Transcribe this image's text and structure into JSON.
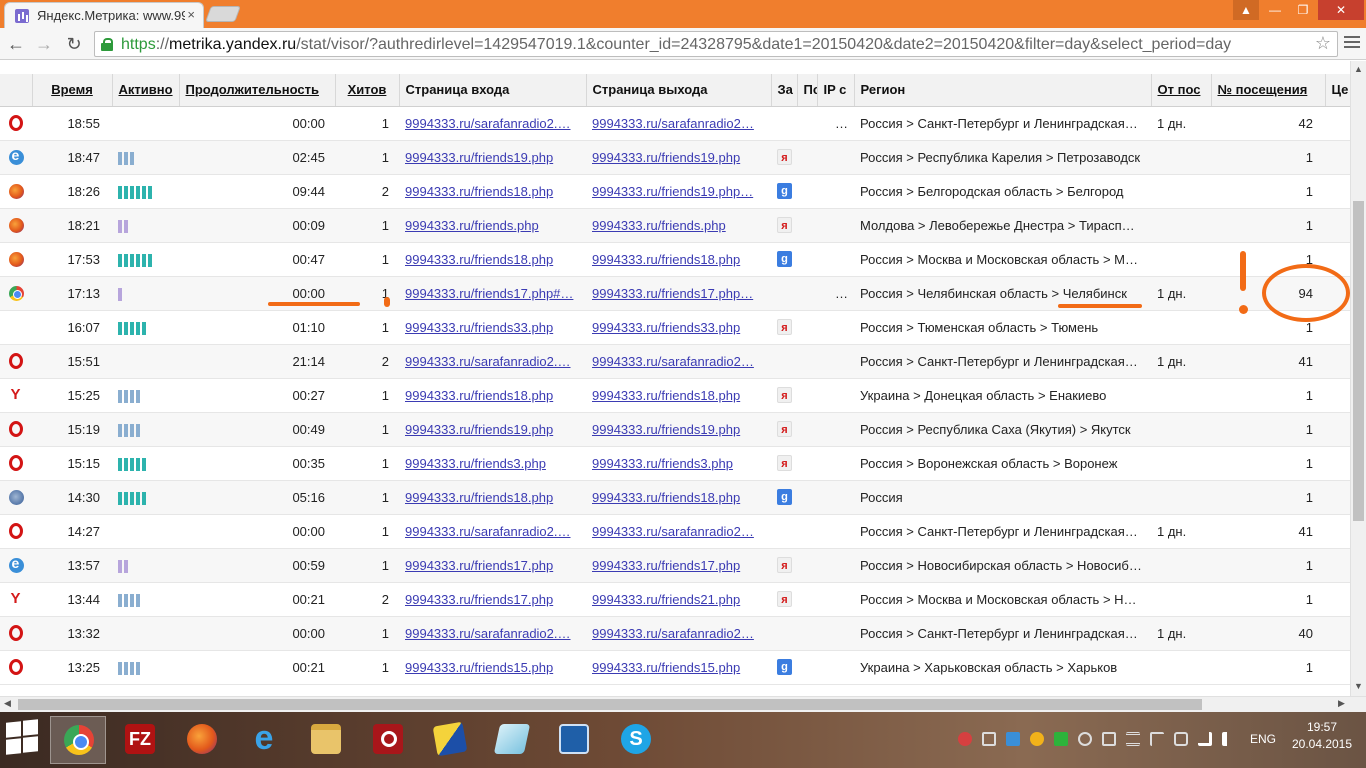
{
  "browser": {
    "tab_title": "Яндекс.Метрика: www.99",
    "tab_close": "×",
    "url_https": "https",
    "url_sep": "://",
    "url_host": "metrika.yandex.ru",
    "url_path": "/stat/visor/?authredirlevel=1429547019.1&counter_id=24328795&date1=20150420&date2=20150420&filter=day&select_period=day",
    "window_buttons": {
      "minimize": "—",
      "maximize": "❐",
      "close": "✕",
      "user": "▲"
    }
  },
  "table": {
    "columns": [
      "",
      "Время",
      "Активно",
      "Продолжительность",
      "Хитов",
      "Страница входа",
      "Страница выхода",
      "За",
      "По",
      "IP с",
      "Регион",
      "От пос",
      "№ посещения",
      "Це"
    ],
    "rows": [
      {
        "browser": "opera",
        "time": "18:55",
        "activity": 0,
        "act_color": "",
        "duration": "00:00",
        "hits": "1",
        "entry": "9994333.ru/sarafanradio2.…",
        "exit": "9994333.ru/sarafanradio2…",
        "search": "",
        "ip": "…",
        "region": "Россия > Санкт-Петербург и Ленинградская…",
        "since": "1 дн.",
        "visit": "42"
      },
      {
        "browser": "ie",
        "time": "18:47",
        "activity": 3,
        "act_color": "blue",
        "duration": "02:45",
        "hits": "1",
        "entry": "9994333.ru/friends19.php",
        "exit": "9994333.ru/friends19.php",
        "search": "ya",
        "ip": "",
        "region": "Россия > Республика Карелия > Петрозаводск",
        "since": "",
        "visit": "1"
      },
      {
        "browser": "firefox",
        "time": "18:26",
        "activity": 6,
        "act_color": "teal",
        "duration": "09:44",
        "hits": "2",
        "entry": "9994333.ru/friends18.php",
        "exit": "9994333.ru/friends19.php…",
        "search": "g",
        "ip": "",
        "region": "Россия > Белгородская область > Белгород",
        "since": "",
        "visit": "1"
      },
      {
        "browser": "firefox",
        "time": "18:21",
        "activity": 2,
        "act_color": "violet",
        "duration": "00:09",
        "hits": "1",
        "entry": "9994333.ru/friends.php",
        "exit": "9994333.ru/friends.php",
        "search": "ya",
        "ip": "",
        "region": "Молдова > Левобережье Днестра > Тирасп…",
        "since": "",
        "visit": "1"
      },
      {
        "browser": "firefox",
        "time": "17:53",
        "activity": 6,
        "act_color": "teal",
        "duration": "00:47",
        "hits": "1",
        "entry": "9994333.ru/friends18.php",
        "exit": "9994333.ru/friends18.php",
        "search": "g",
        "ip": "",
        "region": "Россия > Москва и Московская область > М…",
        "since": "",
        "visit": "1"
      },
      {
        "browser": "chrome",
        "time": "17:13",
        "activity": 1,
        "act_color": "violet",
        "duration": "00:00",
        "hits": "1",
        "entry": "9994333.ru/friends17.php#…",
        "exit": "9994333.ru/friends17.php…",
        "search": "",
        "ip": "…",
        "region": "Россия > Челябинская область > Челябинск",
        "since": "1 дн.",
        "visit": "94"
      },
      {
        "browser": "",
        "time": "16:07",
        "activity": 5,
        "act_color": "teal",
        "duration": "01:10",
        "hits": "1",
        "entry": "9994333.ru/friends33.php",
        "exit": "9994333.ru/friends33.php",
        "search": "ya",
        "ip": "",
        "region": "Россия > Тюменская область > Тюмень",
        "since": "",
        "visit": "1"
      },
      {
        "browser": "opera",
        "time": "15:51",
        "activity": 0,
        "act_color": "",
        "duration": "21:14",
        "hits": "2",
        "entry": "9994333.ru/sarafanradio2.…",
        "exit": "9994333.ru/sarafanradio2…",
        "search": "",
        "ip": "",
        "region": "Россия > Санкт-Петербург и Ленинградская…",
        "since": "1 дн.",
        "visit": "41"
      },
      {
        "browser": "yandex",
        "time": "15:25",
        "activity": 4,
        "act_color": "blue",
        "duration": "00:27",
        "hits": "1",
        "entry": "9994333.ru/friends18.php",
        "exit": "9994333.ru/friends18.php",
        "search": "ya",
        "ip": "",
        "region": "Украина > Донецкая область > Енакиево",
        "since": "",
        "visit": "1"
      },
      {
        "browser": "opera",
        "time": "15:19",
        "activity": 4,
        "act_color": "blue",
        "duration": "00:49",
        "hits": "1",
        "entry": "9994333.ru/friends19.php",
        "exit": "9994333.ru/friends19.php",
        "search": "ya",
        "ip": "",
        "region": "Россия > Республика Саха (Якутия) > Якутск",
        "since": "",
        "visit": "1"
      },
      {
        "browser": "opera",
        "time": "15:15",
        "activity": 5,
        "act_color": "teal",
        "duration": "00:35",
        "hits": "1",
        "entry": "9994333.ru/friends3.php",
        "exit": "9994333.ru/friends3.php",
        "search": "ya",
        "ip": "",
        "region": "Россия > Воронежская область > Воронеж",
        "since": "",
        "visit": "1"
      },
      {
        "browser": "other",
        "time": "14:30",
        "activity": 5,
        "act_color": "teal",
        "duration": "05:16",
        "hits": "1",
        "entry": "9994333.ru/friends18.php",
        "exit": "9994333.ru/friends18.php",
        "search": "g",
        "ip": "",
        "region": "Россия",
        "since": "",
        "visit": "1"
      },
      {
        "browser": "opera",
        "time": "14:27",
        "activity": 0,
        "act_color": "",
        "duration": "00:00",
        "hits": "1",
        "entry": "9994333.ru/sarafanradio2.…",
        "exit": "9994333.ru/sarafanradio2…",
        "search": "",
        "ip": "",
        "region": "Россия > Санкт-Петербург и Ленинградская…",
        "since": "1 дн.",
        "visit": "41"
      },
      {
        "browser": "ie",
        "time": "13:57",
        "activity": 2,
        "act_color": "violet",
        "duration": "00:59",
        "hits": "1",
        "entry": "9994333.ru/friends17.php",
        "exit": "9994333.ru/friends17.php",
        "search": "ya",
        "ip": "",
        "region": "Россия > Новосибирская область > Новосиб…",
        "since": "",
        "visit": "1"
      },
      {
        "browser": "yandex",
        "time": "13:44",
        "activity": 4,
        "act_color": "blue",
        "duration": "00:21",
        "hits": "2",
        "entry": "9994333.ru/friends17.php",
        "exit": "9994333.ru/friends21.php",
        "search": "ya",
        "ip": "",
        "region": "Россия > Москва и Московская область > Н…",
        "since": "",
        "visit": "1"
      },
      {
        "browser": "opera",
        "time": "13:32",
        "activity": 0,
        "act_color": "",
        "duration": "00:00",
        "hits": "1",
        "entry": "9994333.ru/sarafanradio2.…",
        "exit": "9994333.ru/sarafanradio2…",
        "search": "",
        "ip": "",
        "region": "Россия > Санкт-Петербург и Ленинградская…",
        "since": "1 дн.",
        "visit": "40"
      },
      {
        "browser": "opera",
        "time": "13:25",
        "activity": 4,
        "act_color": "blue",
        "duration": "00:21",
        "hits": "1",
        "entry": "9994333.ru/friends15.php",
        "exit": "9994333.ru/friends15.php",
        "search": "g",
        "ip": "",
        "region": "Украина > Харьковская область > Харьков",
        "since": "",
        "visit": "1"
      }
    ]
  },
  "taskbar": {
    "apps": [
      "chrome",
      "filezilla",
      "firefox",
      "internet-explorer",
      "file-explorer",
      "power-app",
      "teamviewer",
      "notepad",
      "settings-app",
      "skype"
    ],
    "filezilla_label": "FZ",
    "skype_label": "S",
    "lang": "ENG",
    "time": "19:57",
    "date": "20.04.2015"
  }
}
